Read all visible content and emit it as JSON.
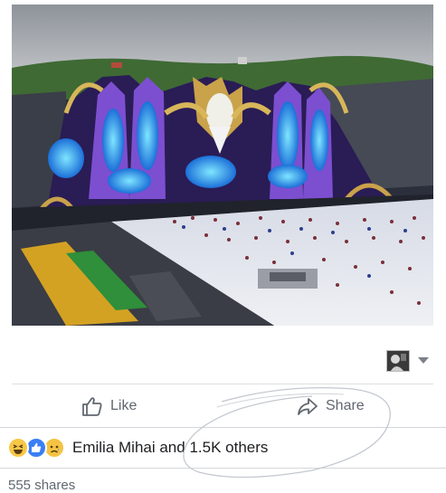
{
  "post": {
    "photo_icon": "festival-stage-photo",
    "actor_icon": "profile-thumbnail-icon",
    "actor_menu_icon": "chevron-down-icon"
  },
  "actions": {
    "like_label": "Like",
    "like_icon": "thumbs-up-icon",
    "share_label": "Share",
    "share_icon": "share-arrow-icon"
  },
  "reactions": {
    "icons": [
      "haha-icon",
      "like-reaction-icon",
      "sad-icon"
    ],
    "names": "Emilia Mihai and 1.5K others"
  },
  "shares": {
    "text": "555 shares"
  },
  "colors": {
    "action_text": "#606770",
    "like_blue": "#3b7ff4",
    "emoji_yellow": "#f7c846"
  }
}
